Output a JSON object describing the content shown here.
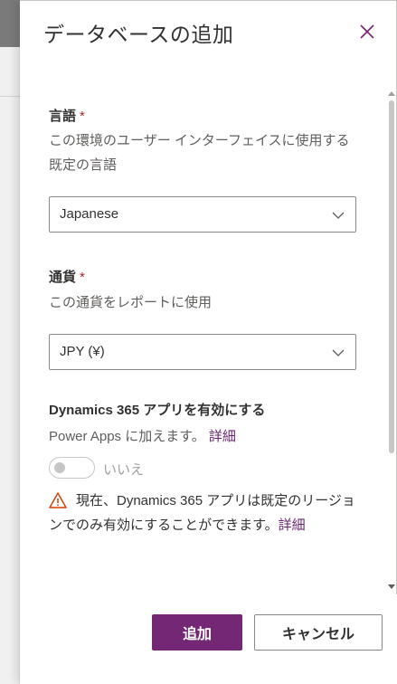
{
  "panel": {
    "title": "データベースの追加",
    "close_icon": "close-icon"
  },
  "language": {
    "label": "言語",
    "required_mark": "*",
    "description": "この環境のユーザー インターフェイスに使用する既定の言語",
    "selected": "Japanese"
  },
  "currency": {
    "label": "通貨",
    "required_mark": "*",
    "description": "この通貨をレポートに使用",
    "selected": "JPY (¥)"
  },
  "dynamics": {
    "label": "Dynamics 365 アプリを有効にする",
    "description": "Power Apps に加えます。",
    "details_link": "詳細",
    "toggle_label": "いいえ",
    "toggle_on": false,
    "warning_text": "現在、Dynamics 365 アプリは既定のリージョンでのみ有効にすることができます。",
    "warning_link": "詳細"
  },
  "footer": {
    "add_label": "追加",
    "cancel_label": "キャンセル"
  },
  "colors": {
    "accent": "#742774",
    "required": "#a4262c",
    "warning": "#d83b01"
  }
}
